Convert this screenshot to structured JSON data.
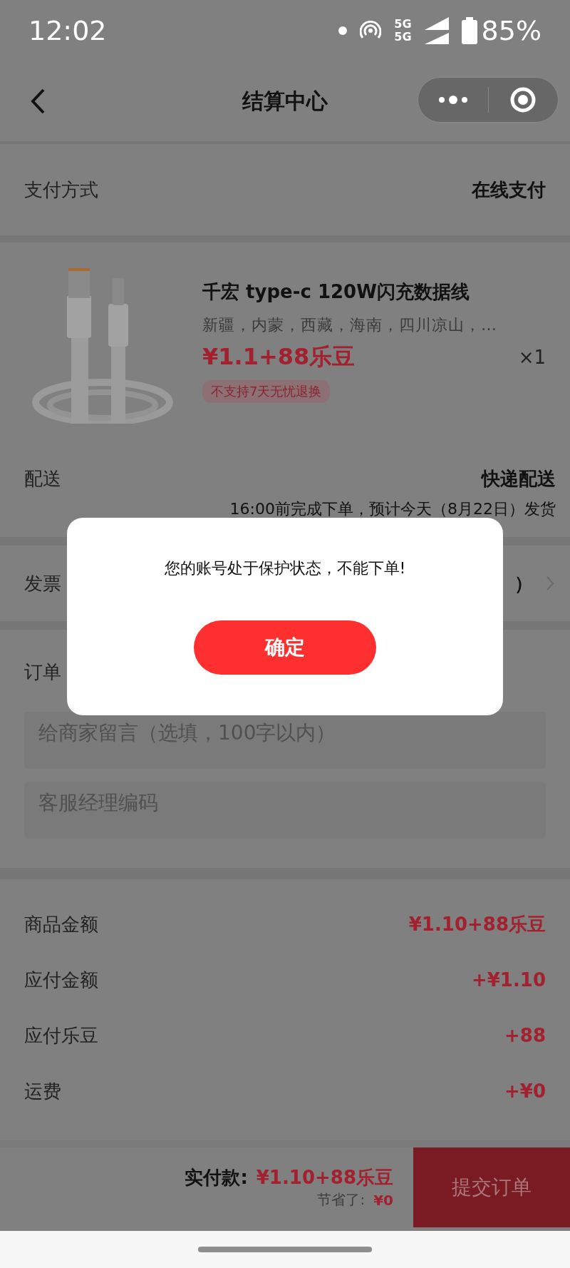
{
  "status_bar": {
    "time": "12:02",
    "network_top": "5G",
    "network_bottom": "5G",
    "battery": "85%"
  },
  "nav": {
    "title": "结算中心"
  },
  "payment": {
    "label": "支付方式",
    "value": "在线支付"
  },
  "product": {
    "name": "千宏 type-c 120W闪充数据线",
    "regions": "新疆，内蒙，西藏，海南，四川凉山，…",
    "price": "¥1.1+88乐豆",
    "quantity": "×1",
    "tag": "不支持7天无忧退换"
  },
  "delivery": {
    "label": "配送",
    "value": "快递配送",
    "note": "16:00前完成下单，预计今天（8月22日）发货"
  },
  "invoice": {
    "label": "发票",
    "value": "）"
  },
  "order_note": {
    "label": "订单",
    "fields": [
      {
        "placeholder": "给商家留言（选填，100字以内）"
      },
      {
        "placeholder": "客服经理编码"
      }
    ]
  },
  "summary": [
    {
      "label": "商品金额",
      "value": "¥1.10+88乐豆"
    },
    {
      "label": "应付金额",
      "value": "+¥1.10"
    },
    {
      "label": "应付乐豆",
      "value": "+88"
    },
    {
      "label": "运费",
      "value": "+¥0"
    }
  ],
  "footer": {
    "total_label": "实付款:",
    "total_value": "¥1.10+88乐豆",
    "saved_label": "节省了:",
    "saved_value": "¥0",
    "submit": "提交订单"
  },
  "dialog": {
    "message": "您的账号处于保护状态，不能下单!",
    "confirm": "确定"
  }
}
